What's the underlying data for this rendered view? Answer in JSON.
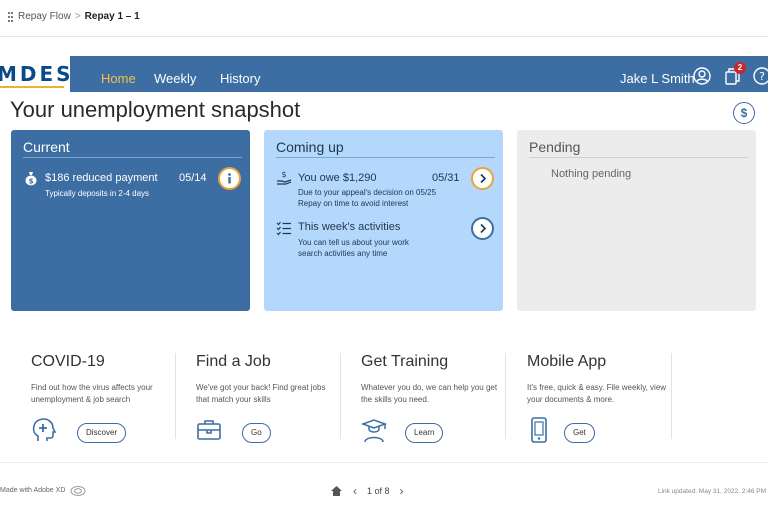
{
  "viewer": {
    "breadcrumb": [
      "Repay Flow",
      "Repay 1 – 1"
    ],
    "made_with": "Made with Adobe XD",
    "pager": "1 of 8",
    "link_updated": "Link updated: May 31, 2022, 2:46 PM"
  },
  "nav": {
    "logo": "MDES",
    "tabs": [
      {
        "label": "Home",
        "active": true
      },
      {
        "label": "Weekly",
        "active": false
      },
      {
        "label": "History",
        "active": false
      }
    ],
    "user_name": "Jake L Smith",
    "notification_count": "2"
  },
  "page": {
    "title": "Your unemployment snapshot",
    "dollar_symbol": "$"
  },
  "cards": {
    "current": {
      "title": "Current",
      "payment": "$186 reduced payment",
      "date": "05/14",
      "note": "Typically deposits in 2-4 days"
    },
    "coming_up": {
      "title": "Coming up",
      "owe": "You owe $1,290",
      "owe_date": "05/31",
      "owe_note1": "Due to your appeal's decision on 05/25",
      "owe_note2": "Repay on time to avoid interest",
      "activities": "This week's activities",
      "act_note1": "You can tell us about your work",
      "act_note2": "search activities any time"
    },
    "pending": {
      "title": "Pending",
      "empty": "Nothing pending"
    }
  },
  "resources": [
    {
      "title": "COVID-19",
      "desc": "Find out how the virus affects your unemployment & job search",
      "button": "Discover",
      "icon": "head-plus-icon"
    },
    {
      "title": "Find a Job",
      "desc": "We've got your back! Find great jobs that match your skills",
      "button": "Go",
      "icon": "briefcase-icon"
    },
    {
      "title": "Get Training",
      "desc": "Whatever you do, we can help you get the skills you need.",
      "button": "Learn",
      "icon": "graduate-icon"
    },
    {
      "title": "Mobile App",
      "desc": "It's free, quick & easy. File weekly, view your documents & more.",
      "button": "Get",
      "icon": "phone-icon"
    }
  ],
  "colors": {
    "nav_blue": "#3d6ea3",
    "coming_blue": "#b3d8fb",
    "accent_orange": "#e8a43a",
    "active_tab": "#f2c14e",
    "badge_red": "#d0242b"
  }
}
